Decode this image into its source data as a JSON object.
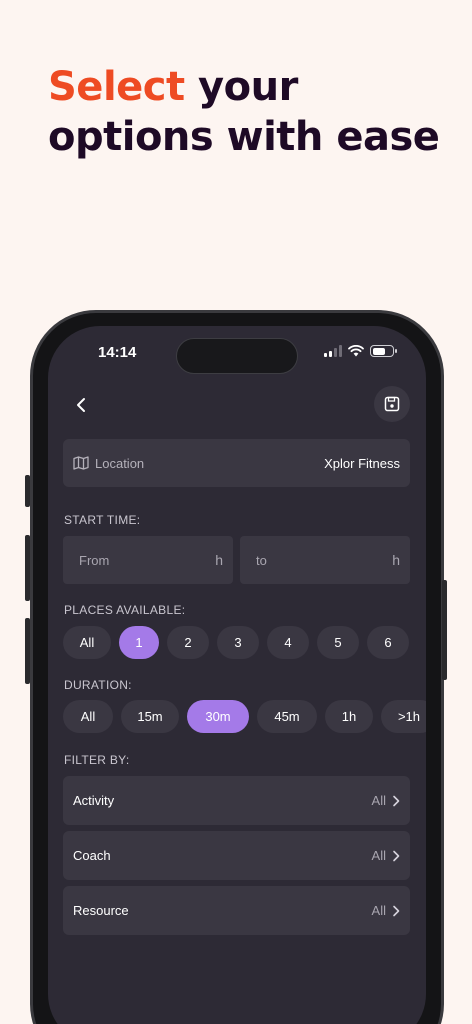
{
  "headline": {
    "accent": "Select",
    "rest_line1": " your",
    "line2": "options with ease"
  },
  "status": {
    "time": "14:14"
  },
  "location": {
    "label": "Location",
    "value": "Xplor Fitness"
  },
  "start_time": {
    "label": "START TIME:",
    "from_placeholder": "From",
    "from_unit": "h",
    "to_placeholder": "to",
    "to_unit": "h"
  },
  "places": {
    "label": "PLACES AVAILABLE:",
    "options": [
      "All",
      "1",
      "2",
      "3",
      "4",
      "5",
      "6"
    ],
    "selected": "1"
  },
  "duration": {
    "label": "DURATION:",
    "options": [
      "All",
      "15m",
      "30m",
      "45m",
      "1h",
      ">1h"
    ],
    "selected": "30m"
  },
  "filter": {
    "label": "FILTER BY:",
    "items": [
      {
        "name": "Activity",
        "value": "All"
      },
      {
        "name": "Coach",
        "value": "All"
      },
      {
        "name": "Resource",
        "value": "All"
      }
    ]
  },
  "colors": {
    "accent_orange": "#ee4b23",
    "chip_selected": "#a47ae8",
    "screen_bg": "#2d2a35",
    "card_bg": "#3a3742"
  }
}
